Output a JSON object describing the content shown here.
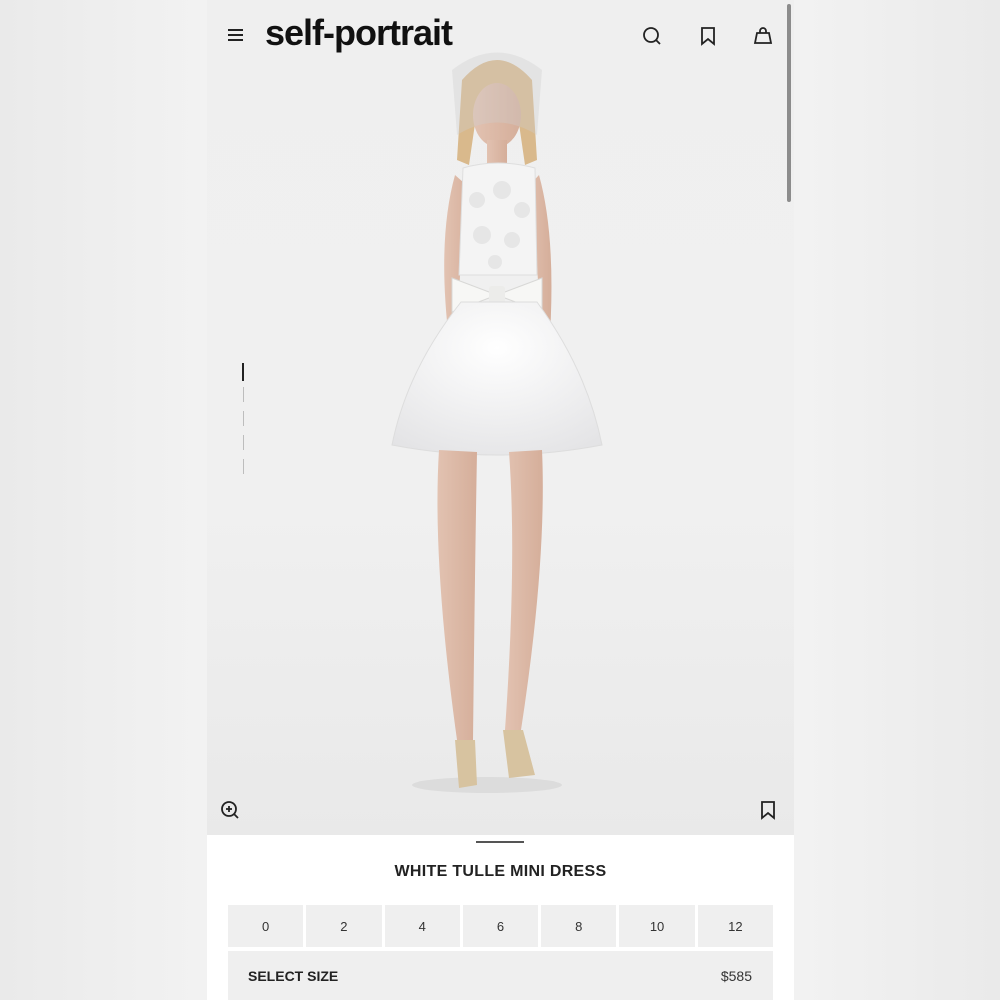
{
  "header": {
    "logo": "self-portrait",
    "icons": [
      "menu-icon",
      "search-icon",
      "bookmark-icon",
      "bag-icon"
    ]
  },
  "gallery": {
    "image_count": 5,
    "active_index": 0,
    "icons": [
      "zoom-in-icon",
      "bookmark-icon"
    ]
  },
  "product": {
    "title": "WHITE TULLE MINI DRESS",
    "sizes": [
      "0",
      "2",
      "4",
      "6",
      "8",
      "10",
      "12"
    ],
    "select_label": "SELECT SIZE",
    "price": "$585"
  }
}
